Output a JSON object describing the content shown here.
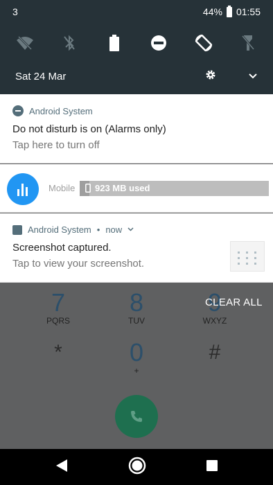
{
  "status": {
    "notif_count": "3",
    "battery": "44%",
    "time": "01:55"
  },
  "shade": {
    "date": "Sat 24 Mar"
  },
  "dnd_card": {
    "app": "Android System",
    "title": "Do not disturb is on (Alarms only)",
    "subtitle": "Tap here to turn off"
  },
  "data_card": {
    "label": "Mobile",
    "usage": "923 MB used",
    "usage_fraction": 0.05
  },
  "screenshot_card": {
    "app": "Android System",
    "time": "now",
    "title": "Screenshot captured.",
    "subtitle": "Tap to view your screenshot."
  },
  "dialer": {
    "clear_all": "CLEAR ALL",
    "keys": [
      {
        "num": "7",
        "letters": "PQRS"
      },
      {
        "num": "8",
        "letters": "TUV"
      },
      {
        "num": "9",
        "letters": "WXYZ"
      },
      {
        "num": "*",
        "letters": ""
      },
      {
        "num": "0",
        "letters": "+"
      },
      {
        "num": "#",
        "letters": ""
      }
    ]
  },
  "colors": {
    "shade_bg": "#263238",
    "accent_blue": "#2196f3",
    "call_green": "#1e6f4f"
  }
}
